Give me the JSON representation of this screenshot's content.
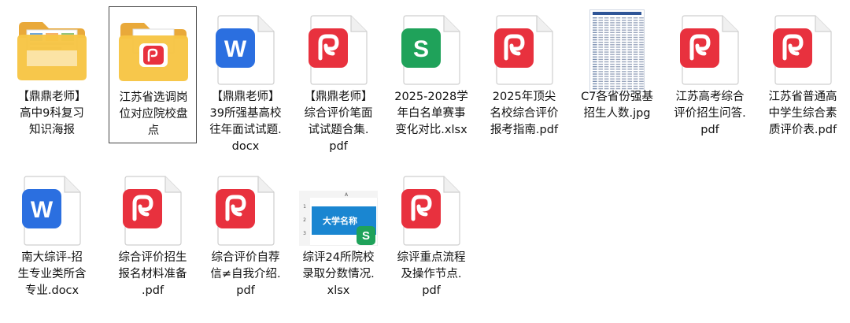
{
  "files": [
    {
      "type": "folder-poster",
      "name": "【鼎鼎老师】高中9科复习知识海报",
      "selected": false,
      "lines": [
        "【鼎鼎老师】",
        "高中9科复习",
        "知识海报"
      ]
    },
    {
      "type": "folder-pdf",
      "name": "江苏省选调岗位对应院校盘点",
      "selected": true,
      "lines": [
        "江苏省选调岗",
        "位对应院校盘",
        "点"
      ]
    },
    {
      "type": "docx",
      "name": "【鼎鼎老师】39所强基高校往年面试试题.docx",
      "selected": false,
      "lines": [
        "【鼎鼎老师】",
        "39所强基高校",
        "往年面试试题.",
        "docx"
      ]
    },
    {
      "type": "pdf",
      "name": "【鼎鼎老师】综合评价笔面试试题合集.pdf",
      "selected": false,
      "lines": [
        "【鼎鼎老师】",
        "综合评价笔面",
        "试试题合集.",
        "pdf"
      ]
    },
    {
      "type": "xlsx",
      "name": "2025-2028学年白名单赛事变化对比.xlsx",
      "selected": false,
      "lines": [
        "2025-2028学",
        "年白名单赛事",
        "变化对比.xlsx"
      ]
    },
    {
      "type": "pdf",
      "name": "2025年顶尖名校综合评价报考指南.pdf",
      "selected": false,
      "lines": [
        "2025年顶尖",
        "名校综合评价",
        "报考指南.pdf"
      ]
    },
    {
      "type": "jpg",
      "name": "C7各省份强基招生人数.jpg",
      "selected": false,
      "lines": [
        "C7各省份强基",
        "招生人数.jpg"
      ]
    },
    {
      "type": "pdf",
      "name": "江苏高考综合评价招生问答.pdf",
      "selected": false,
      "lines": [
        "江苏高考综合",
        "评价招生问答.",
        "pdf"
      ]
    },
    {
      "type": "pdf",
      "name": "江苏省普通高中学生综合素质评价表.pdf",
      "selected": false,
      "lines": [
        "江苏省普通高",
        "中学生综合素",
        "质评价表.pdf"
      ]
    },
    {
      "type": "docx",
      "name": "南大综评-招生专业类所含专业.docx",
      "selected": false,
      "lines": [
        "南大综评-招",
        "生专业类所含",
        "专业.docx"
      ]
    },
    {
      "type": "pdf",
      "name": "综合评价招生报名材料准备.pdf",
      "selected": false,
      "lines": [
        "综合评价招生",
        "报名材料准备",
        ".pdf"
      ]
    },
    {
      "type": "pdf",
      "name": "综合评价自荐信≠自我介绍.pdf",
      "selected": false,
      "lines": [
        "综合评价自荐",
        "信≠自我介绍.",
        "pdf"
      ]
    },
    {
      "type": "xlsx-thumb",
      "name": "综评24所院校录取分数情况.xlsx",
      "selected": false,
      "lines": [
        "综评24所院校",
        "录取分数情况.",
        "xlsx"
      ],
      "preview": {
        "col": "A",
        "rows": [
          "1",
          "2",
          "3"
        ],
        "cell": "大学名称"
      }
    },
    {
      "type": "pdf",
      "name": "综评重点流程及操作节点.pdf",
      "selected": false,
      "lines": [
        "综评重点流程",
        "及操作节点.",
        "pdf"
      ]
    }
  ],
  "icons": {
    "docx_letter": "W",
    "xlsx_letter": "S",
    "pdf_color": "#e8313e",
    "docx_color": "#2b6fe0",
    "xlsx_color": "#1fa25a",
    "folder_color": "#f7c544"
  }
}
